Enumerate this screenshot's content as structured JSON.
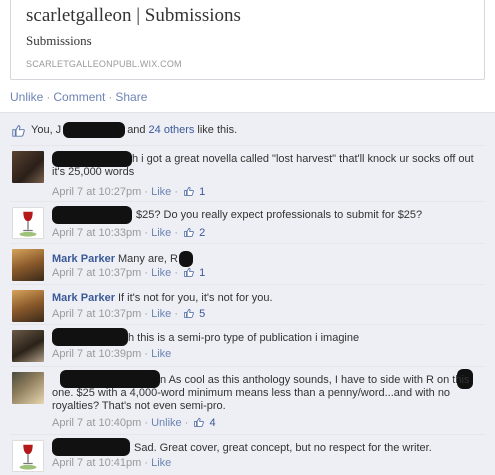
{
  "link": {
    "title": "scarletgalleon | Submissions",
    "description": "Submissions",
    "url": "SCARLETGALLEONPUBL.WIX.COM"
  },
  "actions": {
    "unlike": "Unlike",
    "comment": "Comment",
    "share": "Share",
    "separator": "·"
  },
  "likes": {
    "prefix": "You, J",
    "and": "and",
    "others": "24 others",
    "suffix": "like this."
  },
  "comments": [
    {
      "author": "",
      "text": "h i got a great novella called \"lost harvest\" that'll knock ur socks off out it's 25,000 words",
      "time": "April 7 at 10:27pm",
      "like_label": "Like",
      "like_count": "1"
    },
    {
      "author": "",
      "text": "$25? Do you really expect professionals to submit for $25?",
      "time": "April 7 at 10:33pm",
      "like_label": "Like",
      "like_count": "2"
    },
    {
      "author": "Mark Parker",
      "text": "Many are, R",
      "time": "April 7 at 10:37pm",
      "like_label": "Like",
      "like_count": "1"
    },
    {
      "author": "Mark Parker",
      "text": "If it's not for you, it's not for you.",
      "time": "April 7 at 10:37pm",
      "like_label": "Like",
      "like_count": "5"
    },
    {
      "author": "",
      "text": "h this is a semi-pro type of publication i imagine",
      "time": "April 7 at 10:39pm",
      "like_label": "Like",
      "like_count": ""
    },
    {
      "author": "",
      "text": "n As cool as this anthology sounds, I have to side with R on this one. $25 with a 4,000-word minimum means less than a penny/word...and with no royalties? That's not even semi-pro.",
      "time": "April 7 at 10:40pm",
      "like_label": "Unlike",
      "like_count": "4"
    },
    {
      "author": "",
      "text": "Sad. Great cover, great concept, but no respect for the writer.",
      "time": "April 7 at 10:41pm",
      "like_label": "Like",
      "like_count": ""
    }
  ],
  "colors": {
    "link_blue": "#3b5998",
    "action_blue": "#6d84b4",
    "feedback_bg": "#edeff4",
    "meta_gray": "#999999"
  },
  "icons": {
    "like": "thumbs-up-icon",
    "comment_like": "thumbs-up-icon"
  }
}
